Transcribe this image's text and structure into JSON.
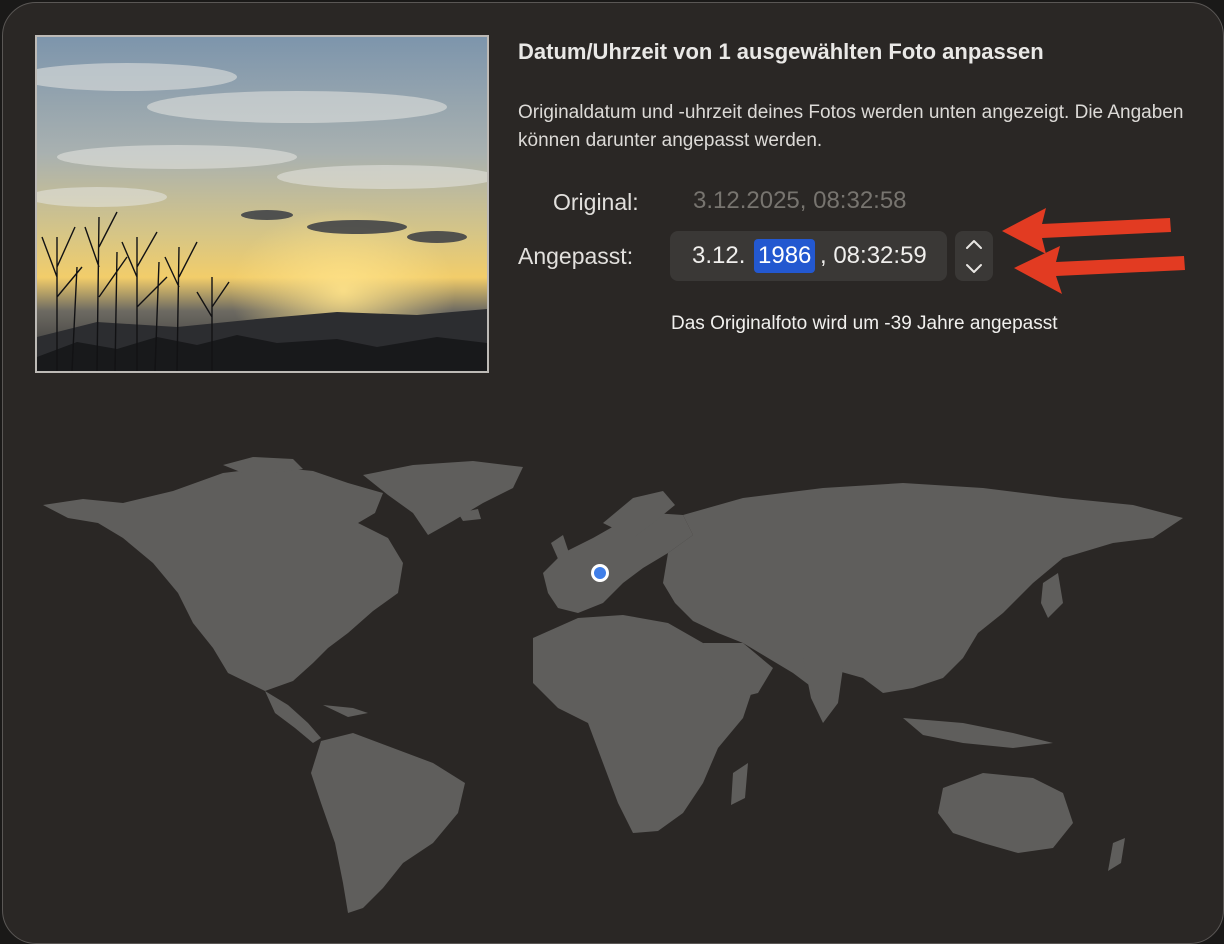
{
  "dialog": {
    "title": "Datum/Uhrzeit von 1 ausgewählten Foto anpassen",
    "description": "Originaldatum und -uhrzeit deines Fotos werden unten angezeigt. Die Angaben können darunter angepasst werden.",
    "original_label": "Original:",
    "original_value": "3.12.2025, 08:32:58",
    "adjusted_label": "Angepasst:",
    "adjusted": {
      "day_month": "3.12.",
      "year": "1986",
      "time": ", 08:32:59"
    },
    "adjustment_hint": "Das Originalfoto wird um -39 Jahre angepasst"
  },
  "icons": {
    "stepper_up": "chevron-up-icon",
    "stepper_down": "chevron-down-icon",
    "location": "location-pin-icon"
  },
  "colors": {
    "background": "#2a2725",
    "selection": "#2358d0",
    "arrow": "#e23b22",
    "land": "#5f5e5c",
    "location_pin": "#3f7ee8"
  }
}
